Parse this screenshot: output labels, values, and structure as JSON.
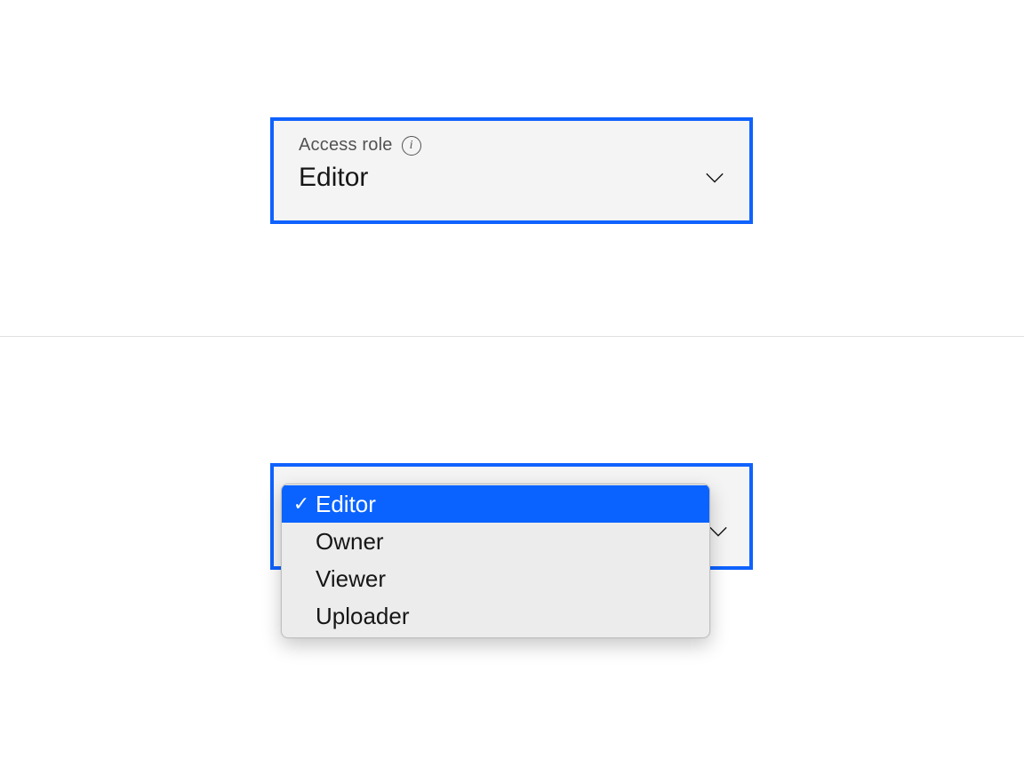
{
  "colors": {
    "focus": "#0f62fe",
    "highlight": "#0a63ff",
    "text_secondary": "#525252"
  },
  "dropdown_closed": {
    "label": "Access role",
    "selected": "Editor"
  },
  "dropdown_open": {
    "options": [
      {
        "label": "Editor",
        "selected": true
      },
      {
        "label": "Owner",
        "selected": false
      },
      {
        "label": "Viewer",
        "selected": false
      },
      {
        "label": "Uploader",
        "selected": false
      }
    ]
  }
}
